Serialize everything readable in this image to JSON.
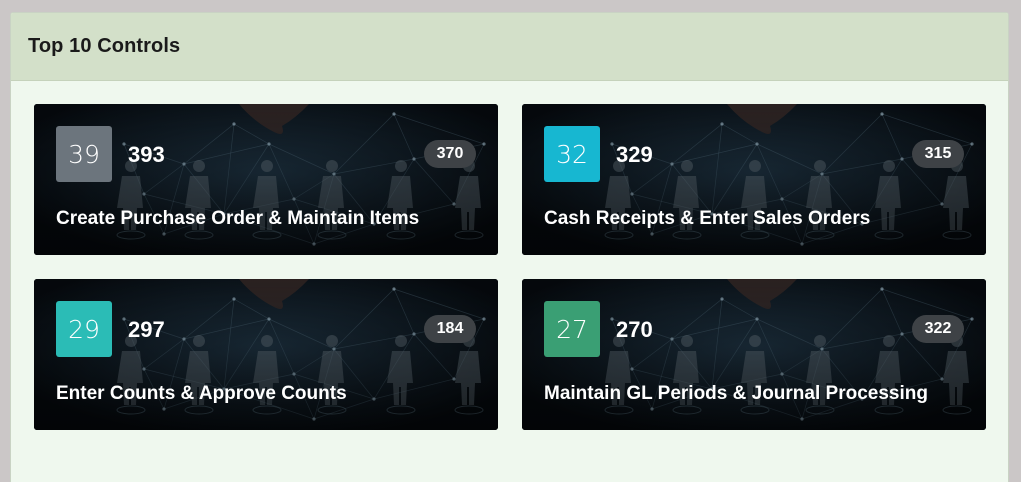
{
  "panel": {
    "title": "Top 10 Controls"
  },
  "cards": [
    {
      "score": "39",
      "total": "393",
      "count": "370",
      "label": "Create Purchase Order & Maintain Items",
      "accent": "#6c757d"
    },
    {
      "score": "32",
      "total": "329",
      "count": "315",
      "label": "Cash Receipts & Enter Sales Orders",
      "accent": "#17b7d1"
    },
    {
      "score": "29",
      "total": "297",
      "count": "184",
      "label": "Enter Counts & Approve Counts",
      "accent": "#2bbcb6"
    },
    {
      "score": "27",
      "total": "270",
      "count": "322",
      "label": "Maintain GL Periods & Journal Processing",
      "accent": "#3a9f74"
    }
  ]
}
